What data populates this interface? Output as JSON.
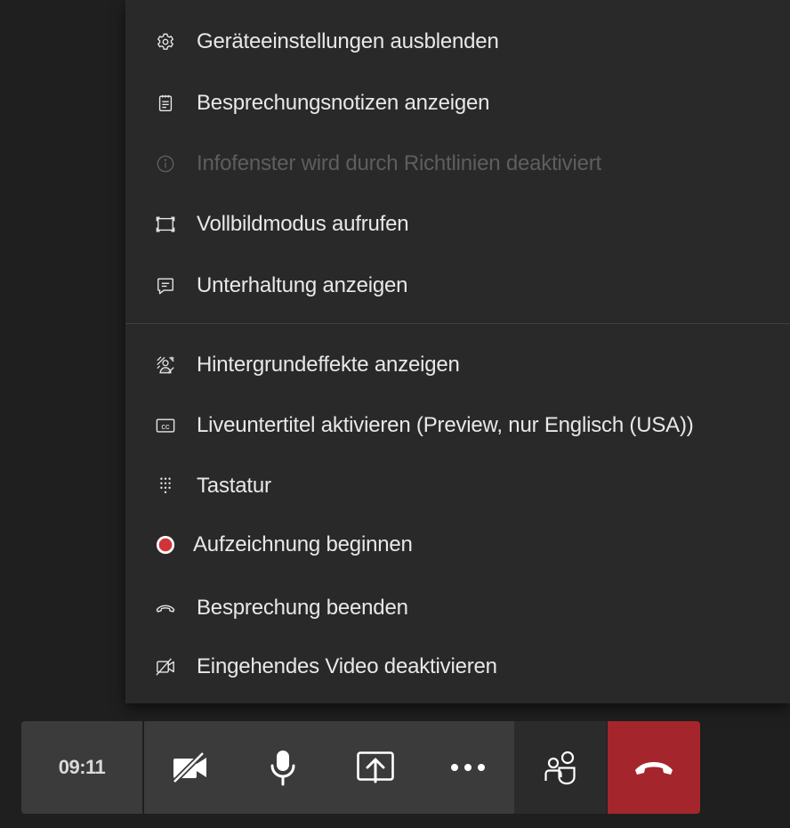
{
  "menu": {
    "items": [
      {
        "label": "Geräteeinstellungen ausblenden",
        "icon": "gear-icon"
      },
      {
        "label": "Besprechungsnotizen anzeigen",
        "icon": "notes-icon"
      },
      {
        "label": "Infofenster wird durch Richtlinien deaktiviert",
        "icon": "info-icon",
        "disabled": true
      },
      {
        "label": "Vollbildmodus aufrufen",
        "icon": "fullscreen-icon"
      },
      {
        "label": "Unterhaltung anzeigen",
        "icon": "chat-icon"
      },
      {
        "label": "Hintergrundeffekte anzeigen",
        "icon": "background-effects-icon"
      },
      {
        "label": "Liveuntertitel aktivieren (Preview, nur Englisch (USA))",
        "icon": "closed-captions-icon",
        "icon_text": "cc"
      },
      {
        "label": "Tastatur",
        "icon": "dialpad-icon"
      },
      {
        "label": "Aufzeichnung beginnen",
        "icon": "record-icon"
      },
      {
        "label": "Besprechung beenden",
        "icon": "hang-up-small-icon"
      },
      {
        "label": "Eingehendes Video deaktivieren",
        "icon": "video-off-icon"
      }
    ]
  },
  "toolbar": {
    "timer": "09:11",
    "buttons": [
      {
        "icon": "camera-off-icon"
      },
      {
        "icon": "microphone-icon"
      },
      {
        "icon": "share-screen-icon"
      },
      {
        "icon": "more-options-icon"
      },
      {
        "icon": "participants-icon"
      },
      {
        "icon": "hang-up-icon"
      }
    ]
  },
  "colors": {
    "menu_bg": "#292929",
    "page_bg": "#1f1f1f",
    "toolbar_bg": "#3b3b3b",
    "hangup_red": "#a4262c",
    "record_red": "#d13438",
    "text": "#e8e8e8",
    "disabled_text": "#5e5e5e"
  }
}
